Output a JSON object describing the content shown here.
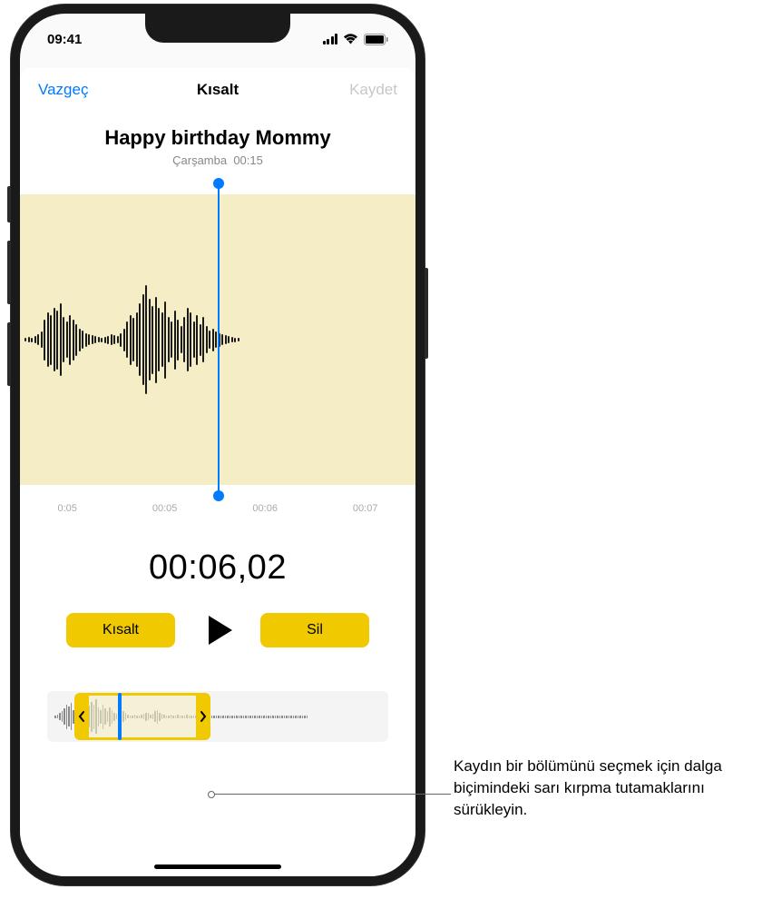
{
  "status_bar": {
    "time": "09:41"
  },
  "nav": {
    "cancel": "Vazgeç",
    "title": "Kısalt",
    "save": "Kaydet"
  },
  "recording": {
    "title": "Happy birthday Mommy",
    "day": "Çarşamba",
    "duration": "00:15"
  },
  "ruler": {
    "t1": "0:05",
    "t2": "00:05",
    "t3": "00:06",
    "t4": "00:07"
  },
  "time_display": "00:06,02",
  "controls": {
    "trim": "Kısalt",
    "delete": "Sil"
  },
  "callout": {
    "text": "Kaydın bir bölümünü seçmek için dalga biçimindeki sarı kırpma tutamaklarını sürükleyin."
  },
  "waveform_heights": [
    4,
    6,
    5,
    8,
    12,
    18,
    45,
    60,
    55,
    70,
    65,
    80,
    50,
    40,
    55,
    45,
    35,
    25,
    20,
    15,
    12,
    10,
    8,
    6,
    5,
    7,
    9,
    12,
    10,
    8,
    15,
    25,
    40,
    55,
    48,
    60,
    80,
    100,
    120,
    90,
    75,
    95,
    70,
    60,
    85,
    50,
    40,
    65,
    45,
    30,
    50,
    70,
    60,
    40,
    55,
    35,
    50,
    30,
    20,
    25,
    18,
    15,
    12,
    10,
    8,
    6,
    5,
    4
  ],
  "mini_waveform_heights": [
    2,
    3,
    5,
    8,
    12,
    18,
    15,
    20,
    10,
    8,
    6,
    5,
    4,
    6,
    10,
    16,
    22,
    18,
    25,
    14,
    10,
    18,
    12,
    8,
    14,
    10,
    6,
    4,
    8,
    12,
    8,
    5,
    3,
    2,
    2,
    3,
    2,
    2,
    3,
    4,
    6,
    5,
    3,
    4,
    8,
    10,
    6,
    4,
    3,
    2,
    2,
    3,
    2,
    2,
    3,
    2,
    2,
    2,
    3,
    2,
    2,
    2,
    2,
    2,
    2,
    2,
    2,
    2,
    2,
    2,
    2,
    2,
    2,
    2,
    2,
    2,
    2,
    2,
    2,
    2,
    2,
    2,
    2,
    2,
    2,
    2,
    2,
    2,
    2,
    2,
    2,
    2,
    2,
    2,
    2,
    2,
    2,
    2,
    2,
    2,
    2,
    2,
    2,
    2,
    2,
    2,
    2,
    2,
    2,
    2,
    2,
    2
  ],
  "colors": {
    "accent_yellow": "#f0c900",
    "accent_blue": "#007AFF",
    "waveform_bg": "#f5edc5"
  }
}
